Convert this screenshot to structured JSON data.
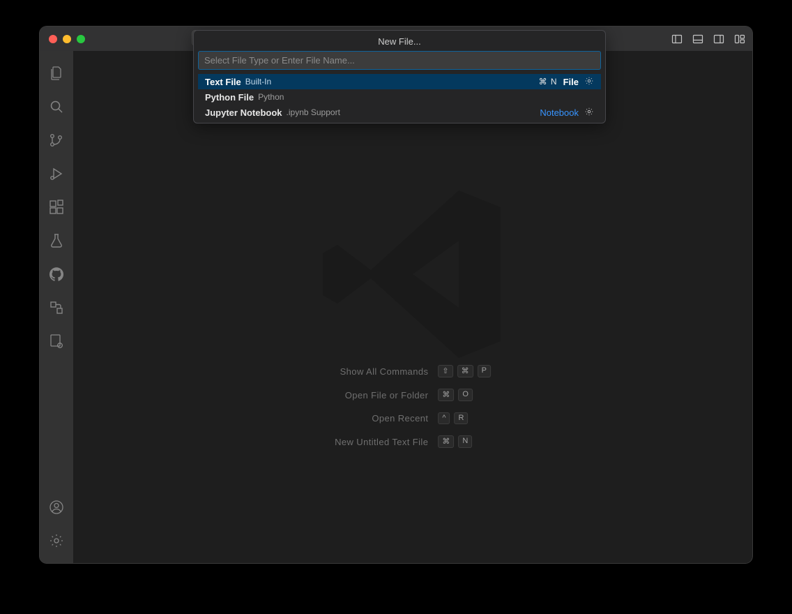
{
  "titlebar": {
    "title": "New File..."
  },
  "quickInput": {
    "placeholder": "Select File Type or Enter File Name...",
    "items": [
      {
        "name": "Text File",
        "detail": "Built-In",
        "shortcut": "⌘  N",
        "category": "File",
        "selected": true,
        "gear": true
      },
      {
        "name": "Python File",
        "detail": "Python",
        "shortcut": "",
        "category": "",
        "selected": false,
        "gear": false
      },
      {
        "name": "Jupyter Notebook",
        "detail": ".ipynb Support",
        "shortcut": "",
        "category": "Notebook",
        "selected": false,
        "gear": true
      }
    ]
  },
  "watermark": {
    "hints": [
      {
        "label": "Show All Commands",
        "keys": [
          "⇧",
          "⌘",
          "P"
        ]
      },
      {
        "label": "Open File or Folder",
        "keys": [
          "⌘",
          "O"
        ]
      },
      {
        "label": "Open Recent",
        "keys": [
          "^",
          "R"
        ]
      },
      {
        "label": "New Untitled Text File",
        "keys": [
          "⌘",
          "N"
        ]
      }
    ]
  },
  "activitybar": {
    "top": [
      "explorer",
      "search",
      "scm",
      "debug",
      "extensions",
      "testing",
      "github",
      "referenced",
      "settings-profile"
    ],
    "bottom": [
      "account",
      "gear"
    ]
  },
  "layoutIcons": [
    "primary-side",
    "panel",
    "secondary-side",
    "customize"
  ]
}
